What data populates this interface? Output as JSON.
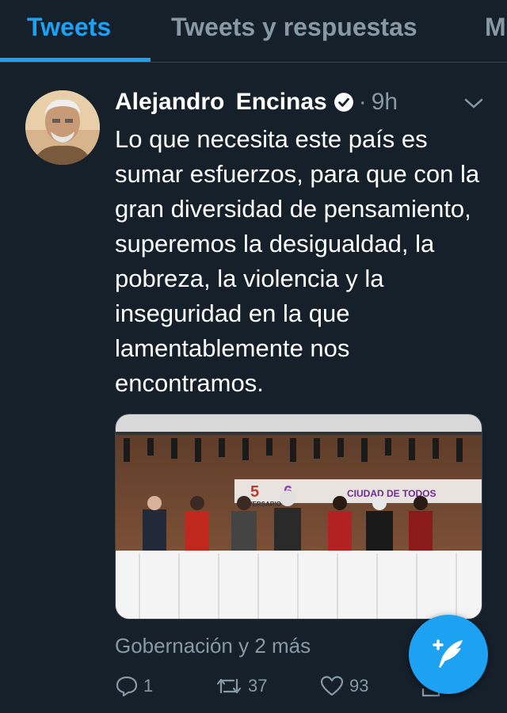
{
  "tabs": [
    {
      "label": "Tweets",
      "active": true
    },
    {
      "label": "Tweets y respuestas",
      "active": false
    },
    {
      "label": "M",
      "active": false
    }
  ],
  "tweet": {
    "author_name": "Alejandro  Encinas",
    "verified": true,
    "separator": "·",
    "time": "9h",
    "text": "Lo que necesita este país es sumar esfuerzos, para que con la gran diversidad de pensamiento, superemos la desigualdad, la pobreza, la violencia y la inseguridad en la que lamentablemente nos encontramos.",
    "media_caption": "Gobernación y 2 más",
    "banner_text": {
      "number_left": "5",
      "number_right": "6",
      "anniversary": "IVERSARIO",
      "city": "CIUDAD DE TODOS"
    },
    "actions": {
      "replies": "1",
      "retweets": "37",
      "likes": "93"
    }
  },
  "colors": {
    "background": "#15202b",
    "accent": "#1da1f2",
    "secondary_text": "#8899a6",
    "divider": "#38444d"
  },
  "icons": {
    "verified": "verified-badge-icon",
    "menu": "chevron-down-icon",
    "reply": "reply-icon",
    "retweet": "retweet-icon",
    "like": "heart-icon",
    "share": "share-icon",
    "compose": "compose-feather-icon"
  }
}
